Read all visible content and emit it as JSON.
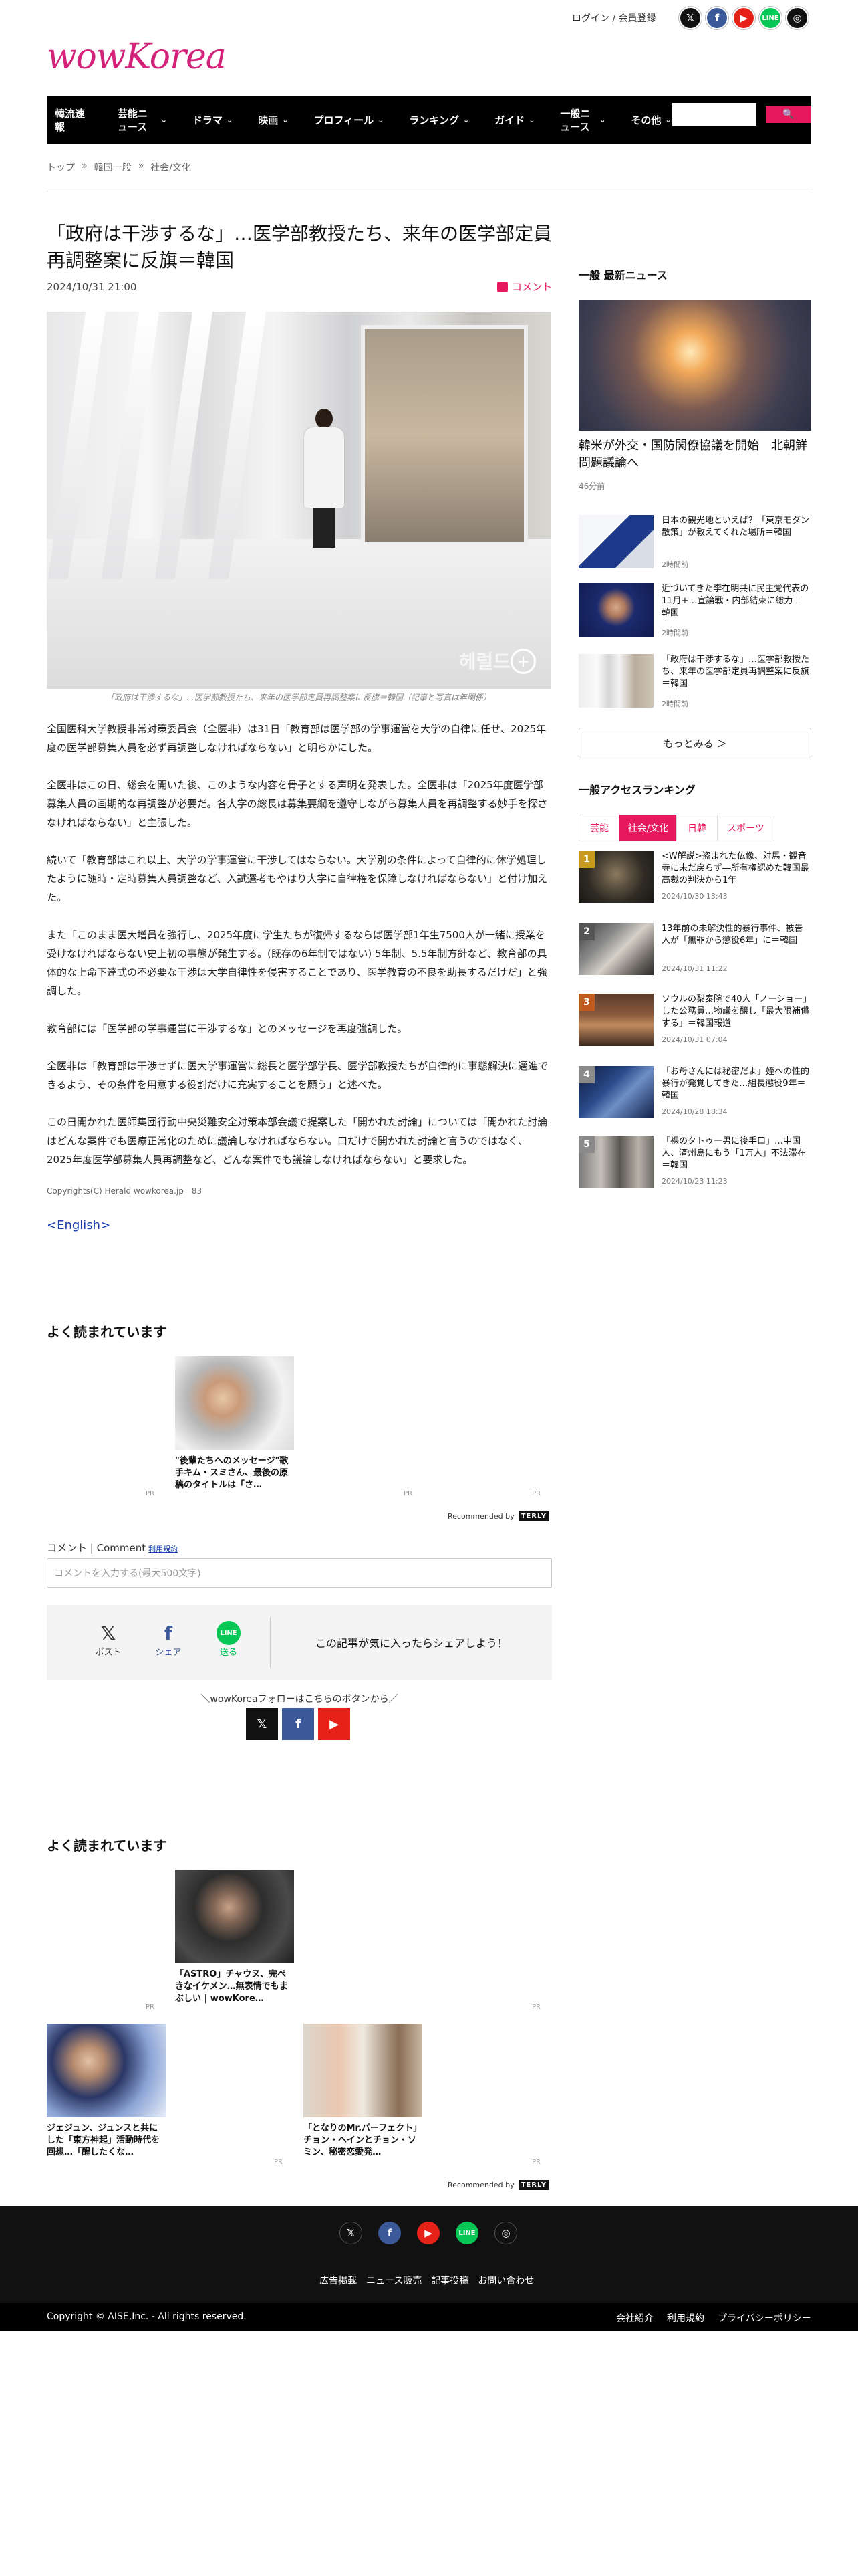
{
  "header": {
    "login": "ログイン / 会員登録",
    "logo": "wowKorea",
    "nav": [
      "韓流速報",
      "芸能ニュース",
      "ドラマ",
      "映画",
      "プロフィール",
      "ランキング",
      "ガイド",
      "一般ニュース",
      "その他"
    ],
    "search_button": "🔍"
  },
  "breadcrumb": [
    "トップ",
    "»",
    "韓国一般",
    "»",
    "社会/文化"
  ],
  "article": {
    "headline": "「政府は干渉するな」…医学部教授たち、来年の医学部定員再調整案に反旗＝韓国",
    "date": "2024/10/31 21:00",
    "comment_label": "コメント",
    "caption": "「政府は干渉するな」…医学部教授たち、来年の医学部定員再調整案に反旗＝韓国（記事と写真は無関係）",
    "paragraphs": [
      "全国医科大学教授非常対策委員会（全医非）は31日「教育部は医学部の学事運営を大学の自律に任せ、2025年度の医学部募集人員を必ず再調整しなければならない」と明らかにした。",
      "全医非はこの日、総会を開いた後、このような内容を骨子とする声明を発表した。全医非は「2025年度医学部募集人員の画期的な再調整が必要だ。各大学の総長は募集要綱を遵守しながら募集人員を再調整する妙手を探さなければならない」と主張した。",
      "続いて「教育部はこれ以上、大学の学事運営に干渉してはならない。大学別の条件によって自律的に休学処理したように随時・定時募集人員調整など、入試選考もやはり大学に自律権を保障しなければならない」と付け加えた。",
      "また「このまま医大増員を強行し、2025年度に学生たちが復帰するならば医学部1年生7500人が一緒に授業を受けなければならない史上初の事態が発生する。(既存の6年制ではない) 5年制、5.5年制方針など、教育部の具体的な上命下達式の不必要な干渉は大学自律性を侵害することであり、医学教育の不良を助長するだけだ」と強調した。",
      "教育部には「医学部の学事運営に干渉するな」とのメッセージを再度強調した。",
      "全医非は「教育部は干渉せずに医大学事運営に総長と医学部学長、医学部教授たちが自律的に事態解決に邁進できるよう、その条件を用意する役割だけに充実することを願う」と述べた。",
      "この日開かれた医師集団行動中央災難安全対策本部会議で提案した「開かれた討論」については「開かれた討論はどんな案件でも医療正常化のために議論しなければならない。口だけで開かれた討論と言うのではなく、2025年度医学部募集人員再調整など、どんな案件でも議論しなければならない」と要求した。"
    ],
    "copyright": "Copyrights(C) Herald wowkorea.jp　83",
    "english_link": "<English>"
  },
  "sidebar": {
    "latest_title": "一般 最新ニュース",
    "main": {
      "title": "韓米が外交・国防閣僚協議を開始　北朝鮮問題議論へ",
      "time": "46分前"
    },
    "items": [
      {
        "title": "日本の観光地といえば？「東京モダン散策」が教えてくれた場所＝韓国",
        "time": "2時間前"
      },
      {
        "title": "近づいてきた李在明共に民主党代表の11月+…宣論戦・内部結束に総力＝韓国",
        "time": "2時間前"
      },
      {
        "title": "「政府は干渉するな」…医学部教授たち、来年の医学部定員再調整案に反旗＝韓国",
        "time": "2時間前"
      }
    ],
    "more": "もっとみる ＞",
    "ranking_title": "一般アクセスランキング",
    "tabs": [
      "芸能",
      "社会/文化",
      "日韓",
      "スポーツ"
    ],
    "ranking": [
      {
        "num": "1",
        "title": "<W解説>盗まれた仏像、対馬・観音寺に未だ戻らず―所有権認めた韓国最高裁の判決から1年",
        "time": "2024/10/30 13:43"
      },
      {
        "num": "2",
        "title": "13年前の未解決性的暴行事件、被告人が「無罪から懲役6年」に＝韓国",
        "time": "2024/10/31 11:22"
      },
      {
        "num": "3",
        "title": "ソウルの梨泰院で40人「ノーショー」した公務員…物議を醸し「最大限補償する」＝韓国報道",
        "time": "2024/10/31 07:04"
      },
      {
        "num": "4",
        "title": "「お母さんには秘密だよ」姪への性的暴行が発覚してきた…組長懲役9年＝韓国",
        "time": "2024/10/28 18:34"
      },
      {
        "num": "5",
        "title": "「裸のタトゥー男に後手口」…中国人、済州島にもう「1万人」不法滞在＝韓国",
        "time": "2024/10/23 11:23"
      }
    ]
  },
  "recommend1": {
    "title": "よく読まれています",
    "card": "\"後輩たちへのメッセージ\"歌手キム・スミさん、最後の原稿のタイトルは「さ…",
    "pr": [
      "PR",
      "PR",
      "PR"
    ],
    "by": "Recommended by",
    "by_logo": "TERLY"
  },
  "comment": {
    "label": "コメント | Comment",
    "rule": "利用規約",
    "placeholder": "コメントを入力する(最大500文字)"
  },
  "share": {
    "post": "ポスト",
    "share": "シェア",
    "line": "送る",
    "text": "この記事が気に入ったらシェアしよう！",
    "follow": "＼wowKoreaフォローはこちらのボタンから／"
  },
  "recommend2": {
    "title": "よく読まれています",
    "cards": [
      "「ASTRO」チャウヌ、完ぺきなイケメン…無表情でもまぶしい | wowKore…",
      "ジェジュン、ジュンスと共にした「東方神起」活動時代を回想…「醒したくな…",
      "「となりのMr.パーフェクト」チョン・ヘインとチョン・ソミン、秘密恋愛発…"
    ],
    "pr": [
      "PR",
      "PR",
      "PR",
      "PR"
    ],
    "by": "Recommended by",
    "by_logo": "TERLY"
  },
  "footer": {
    "links": [
      "広告掲載",
      "ニュース販売",
      "記事投稿",
      "お問い合わせ"
    ],
    "copyright": "Copyright © AISE,Inc. - All rights reserved.",
    "bottom_links": [
      "会社紹介",
      "利用規約",
      "プライバシーポリシー"
    ]
  }
}
